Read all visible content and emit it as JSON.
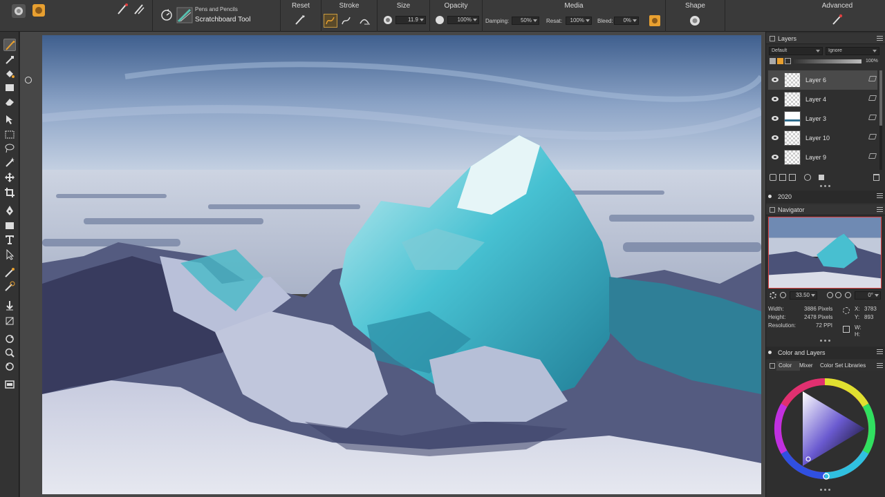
{
  "property_bar": {
    "tool_category": "Pens and Pencils",
    "tool_name": "Scratchboard Tool",
    "sections": {
      "reset": "Reset",
      "stroke": "Stroke",
      "size": "Size",
      "opacity": "Opacity",
      "media": "Media",
      "shape": "Shape",
      "advanced": "Advanced"
    },
    "size_value": "11.9",
    "opacity_value": "100%",
    "damping_label": "Damping:",
    "damping_value": "50%",
    "resat_label": "Resat:",
    "resat_value": "100%",
    "bleed_label": "Bleed:",
    "bleed_value": "0%"
  },
  "toolbox": {
    "tools": [
      "brush-tool",
      "dropper-tool",
      "paint-bucket-tool",
      "fill-tool",
      "eraser-tool",
      "transform-tool",
      "rectangle-select-tool",
      "lasso-tool",
      "magic-wand-tool",
      "move-tool",
      "crop-tool",
      "pen-tool",
      "shape-tool",
      "text-tool",
      "shape-selection-tool",
      "cloner-tool",
      "rubber-stamp-tool",
      "layer-adjuster-tool",
      "dodge-tool",
      "rotate-page-tool",
      "magnifier-tool",
      "grabber-tool",
      "screen-mode-tool"
    ]
  },
  "layers_panel": {
    "title": "Layers",
    "composite_method": "Default",
    "composite_depth": "Ignore",
    "opacity": "100%",
    "layers": [
      {
        "name": "Layer 6",
        "selected": true
      },
      {
        "name": "Layer 4",
        "selected": false
      },
      {
        "name": "Layer 3",
        "selected": false
      },
      {
        "name": "Layer 10",
        "selected": false
      },
      {
        "name": "Layer 9",
        "selected": false
      }
    ]
  },
  "group_2020": {
    "title": "2020"
  },
  "navigator": {
    "title": "Navigator",
    "zoom": "33.50",
    "rotation": "0°",
    "width_label": "Width:",
    "width_value": "3886 Pixels",
    "height_label": "Height:",
    "height_value": "2478 Pixels",
    "resolution_label": "Resolution:",
    "resolution_value": "72 PPI",
    "x_label": "X:",
    "x_value": "3783",
    "y_label": "Y:",
    "y_value": "893",
    "w_label": "W:",
    "w_value": "",
    "h_label": "H:",
    "h_value": ""
  },
  "color_and_layers": {
    "title": "Color and Layers",
    "tabs": [
      "Color",
      "Mixer",
      "Color Set Libraries"
    ],
    "active_tab": "Color"
  },
  "colors": {
    "accent_orange": "#e8a030",
    "selection": "#4a4a4a"
  }
}
